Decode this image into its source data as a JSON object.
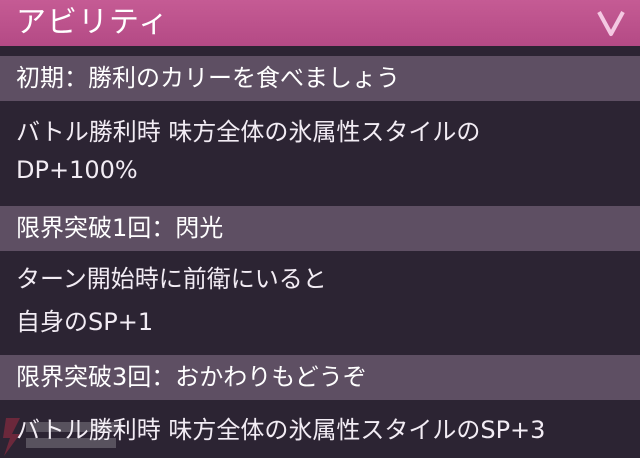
{
  "header": {
    "title": "アビリティ",
    "collapse_icon": "chevron-down-icon"
  },
  "abilities": [
    {
      "heading": "初期：勝利のカリーを食べましょう",
      "lines": [
        "バトル勝利時 味方全体の氷属性スタイルの",
        "DP+100%"
      ]
    },
    {
      "heading": "限界突破1回：閃光",
      "lines": [
        "ターン開始時に前衛にいると",
        "自身のSP+1"
      ]
    },
    {
      "heading": "限界突破3回：おかわりもどうぞ",
      "lines": [
        "バトル勝利時 味方全体の氷属性スタイルのSP+3"
      ]
    }
  ],
  "colors": {
    "header": "#b44a85",
    "section_head": "#5e4f63",
    "body_bg": "#2c2433"
  }
}
